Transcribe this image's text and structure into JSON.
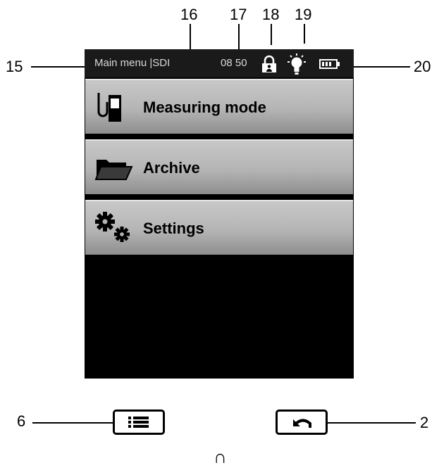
{
  "callouts": {
    "c15": "15",
    "c16": "16",
    "c17": "17",
    "c18": "18",
    "c19": "19",
    "c20": "20",
    "c6": "6",
    "c2": "2"
  },
  "status_bar": {
    "title": "Main menu |SDI",
    "time": "08 50",
    "icons": [
      "lock-icon",
      "light-bulb-icon",
      "battery-icon"
    ]
  },
  "menu": {
    "items": [
      {
        "label": "Measuring mode",
        "icon": "measuring-probe-icon"
      },
      {
        "label": "Archive",
        "icon": "folder-icon"
      },
      {
        "label": "Settings",
        "icon": "gears-icon"
      }
    ]
  },
  "hardware_buttons": {
    "menu_icon": "list-icon",
    "back_icon": "back-arrow-icon"
  },
  "bottom_glyph": "∩",
  "colors": {
    "screen_bg": "#000000",
    "status_bar_bg": "#1a1a1a",
    "status_text": "#d9d9d9",
    "menu_item_top": "#c8c8c8",
    "menu_item_bottom": "#8e8e8e"
  }
}
